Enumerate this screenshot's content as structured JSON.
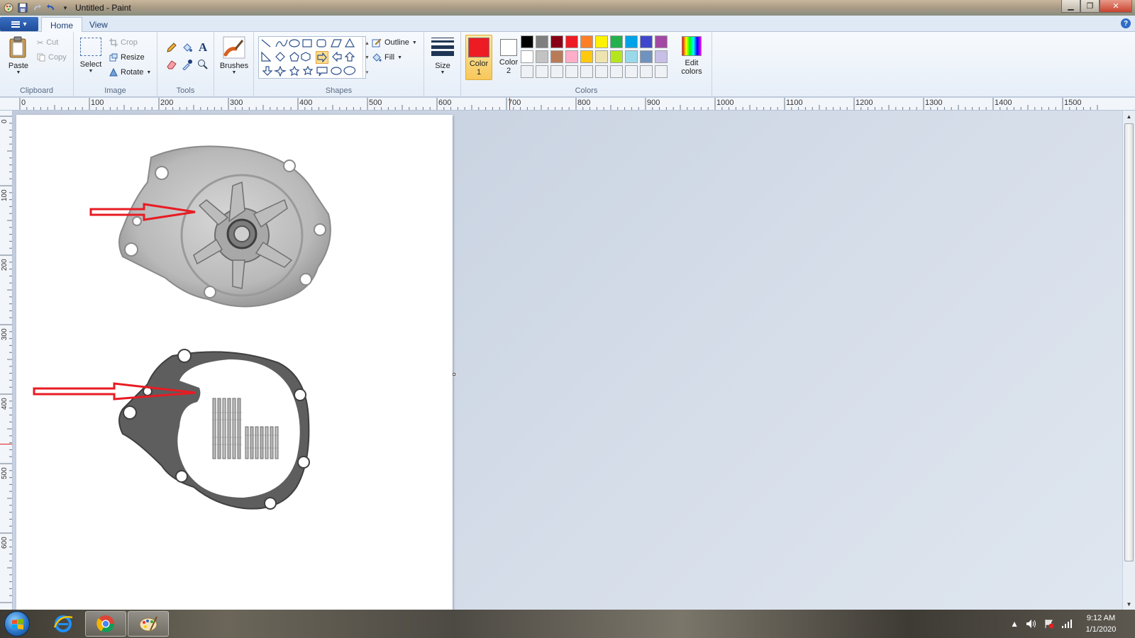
{
  "window": {
    "title": "Untitled - Paint",
    "controls": {
      "minimize": "▁",
      "maximize": "❐",
      "close": "✕"
    }
  },
  "tabs": [
    {
      "label": "Home",
      "active": true
    },
    {
      "label": "View",
      "active": false
    }
  ],
  "ribbon": {
    "clipboard": {
      "label": "Clipboard",
      "paste": "Paste",
      "cut": "Cut",
      "copy": "Copy"
    },
    "image": {
      "label": "Image",
      "select": "Select",
      "crop": "Crop",
      "resize": "Resize",
      "rotate": "Rotate"
    },
    "tools": {
      "label": "Tools"
    },
    "brushes": {
      "label": "Brushes"
    },
    "shapes": {
      "label": "Shapes",
      "outline": "Outline",
      "fill": "Fill"
    },
    "size": {
      "label": "Size"
    },
    "colors": {
      "label": "Colors",
      "color1_label": "Color\n1",
      "color1_line1": "Color",
      "color1_line2": "1",
      "color2_line1": "Color",
      "color2_line2": "2",
      "color1": "#ed1c24",
      "color2": "#ffffff",
      "edit_line1": "Edit",
      "edit_line2": "colors",
      "palette": [
        "#000000",
        "#7f7f7f",
        "#880015",
        "#ed1c24",
        "#ff7f27",
        "#fff200",
        "#22b14c",
        "#00a2e8",
        "#3f48cc",
        "#a349a4",
        "#ffffff",
        "#c3c3c3",
        "#b97a57",
        "#ffaec9",
        "#ffc90e",
        "#efe4b0",
        "#b5e61d",
        "#99d9ea",
        "#7092be",
        "#c8bfe7",
        "#eef1f6",
        "#eef1f6",
        "#eef1f6",
        "#eef1f6",
        "#eef1f6",
        "#eef1f6",
        "#eef1f6",
        "#eef1f6",
        "#eef1f6",
        "#eef1f6"
      ]
    }
  },
  "ruler": {
    "h_labels": [
      "0",
      "100",
      "200",
      "300",
      "400",
      "500",
      "600",
      "700",
      "800",
      "900",
      "1000",
      "1100",
      "1200",
      "1300",
      "1400",
      "1500"
    ],
    "v_labels": [
      "0",
      "100",
      "200",
      "300",
      "400",
      "500",
      "600"
    ]
  },
  "taskbar": {
    "time": "9:12 AM",
    "date": "1/1/2020"
  }
}
